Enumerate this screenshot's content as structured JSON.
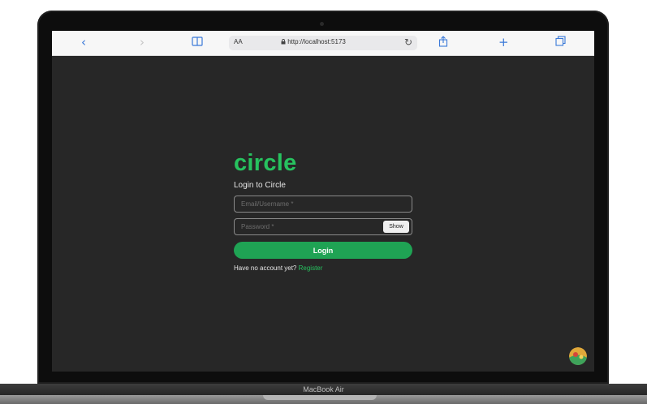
{
  "device": {
    "label": "MacBook Air"
  },
  "browser": {
    "text_size_label": "AA",
    "url": "http://localhost:5173",
    "icons": {
      "back": "chevron-left-icon",
      "forward": "chevron-right-icon",
      "reader": "book-icon",
      "reload": "reload-icon",
      "share": "share-icon",
      "new_tab": "plus-icon",
      "tabs": "tabs-icon"
    }
  },
  "login": {
    "logo": "circle",
    "subtitle": "Login to Circle",
    "email_placeholder": "Email/Username *",
    "password_placeholder": "Password *",
    "show_label": "Show",
    "submit_label": "Login",
    "no_account_text": "Have no account yet?",
    "register_label": "Register"
  },
  "colors": {
    "accent": "#27c25f",
    "button": "#1fa354",
    "background": "#272727"
  }
}
